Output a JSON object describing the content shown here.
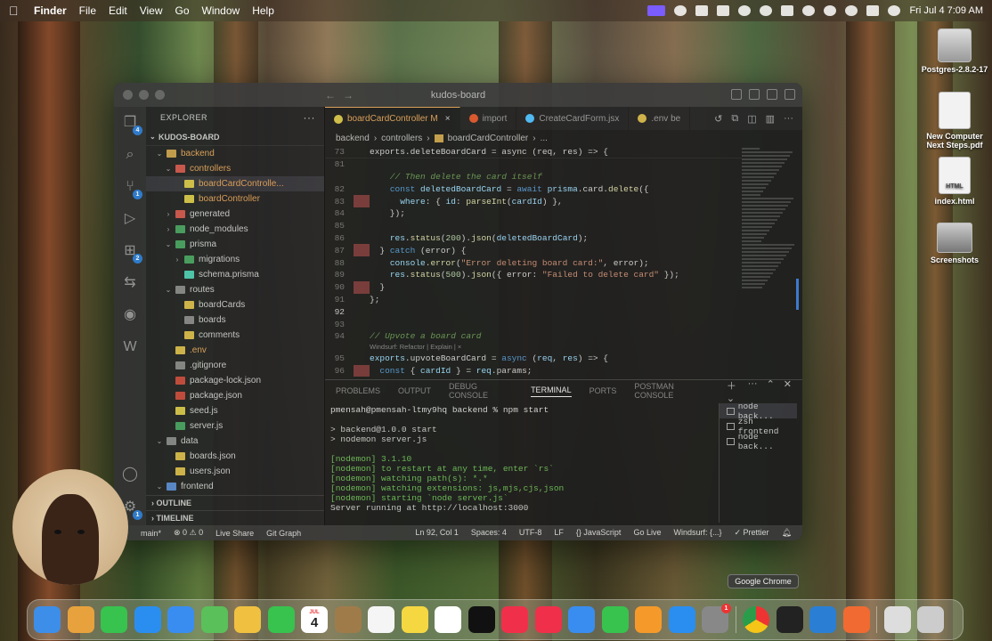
{
  "menubar": {
    "app": "Finder",
    "items": [
      "File",
      "Edit",
      "View",
      "Go",
      "Window",
      "Help"
    ],
    "clock": "Fri Jul 4  7:09 AM"
  },
  "desktop": {
    "items": [
      {
        "label": "Postgres-2.8.2-17"
      },
      {
        "label": "New Computer Next Steps.pdf"
      },
      {
        "label": "index.html",
        "icon_text": "HTML"
      },
      {
        "label": "Screenshots"
      }
    ]
  },
  "vscode": {
    "window_title": "kudos-board",
    "explorer": {
      "header": "EXPLORER",
      "root": "KUDOS-BOARD",
      "tree": [
        {
          "label": "backend",
          "chev": "⌄",
          "icon": "f-folder"
        },
        {
          "label": "controllers",
          "chev": "⌄",
          "icon": "f-red"
        },
        {
          "label": "boardCardControlle...",
          "chev": "",
          "icon": "f-js"
        },
        {
          "label": "boardController",
          "chev": "",
          "icon": "f-js"
        },
        {
          "label": "generated",
          "chev": "›",
          "icon": "f-red"
        },
        {
          "label": "node_modules",
          "chev": "›",
          "icon": "f-green"
        },
        {
          "label": "prisma",
          "chev": "⌄",
          "icon": "f-green"
        },
        {
          "label": "migrations",
          "chev": "›",
          "icon": "f-green"
        },
        {
          "label": "schema.prisma",
          "chev": "",
          "icon": "f-prisma"
        },
        {
          "label": "routes",
          "chev": "⌄",
          "icon": "f-gray"
        },
        {
          "label": "boardCards",
          "chev": "",
          "icon": "f-json"
        },
        {
          "label": "boards",
          "chev": "",
          "icon": "f-gray"
        },
        {
          "label": "comments",
          "chev": "",
          "icon": "f-json"
        },
        {
          "label": ".env",
          "chev": "",
          "icon": "f-json"
        },
        {
          "label": ".gitignore",
          "chev": "",
          "icon": "f-gray"
        },
        {
          "label": "package-lock.json",
          "chev": "",
          "icon": "f-pkg"
        },
        {
          "label": "package.json",
          "chev": "",
          "icon": "f-pkg"
        },
        {
          "label": "seed.js",
          "chev": "",
          "icon": "f-js"
        },
        {
          "label": "server.js",
          "chev": "",
          "icon": "f-green"
        },
        {
          "label": "data",
          "chev": "⌄",
          "icon": "f-gray"
        },
        {
          "label": "boards.json",
          "chev": "",
          "icon": "f-json"
        },
        {
          "label": "users.json",
          "chev": "",
          "icon": "f-json"
        },
        {
          "label": "frontend",
          "chev": "⌄",
          "icon": "f-blue"
        }
      ],
      "outline": "OUTLINE",
      "timeline": "TIMELINE"
    },
    "tabs": [
      {
        "label": "boardCardController M",
        "active": true,
        "close": "×"
      },
      {
        "label": "import",
        "active": false
      },
      {
        "label": "CreateCardForm.jsx",
        "active": false
      },
      {
        "label": ".env be",
        "active": false
      }
    ],
    "breadcrumb": [
      "backend",
      "controllers",
      "boardCardController",
      "..."
    ],
    "code": {
      "sticky": {
        "num": "73",
        "text": "exports.deleteBoardCard = async (req, res) => {"
      },
      "lines": [
        {
          "num": "81",
          "text": "",
          "gutter": false
        },
        {
          "num": "",
          "text": "    // Then delete the card itself",
          "cls": "cm",
          "gutter": false
        },
        {
          "num": "82",
          "text": "    const deletedBoardCard = await prisma.card.delete({",
          "gutter": false
        },
        {
          "num": "83",
          "text": "      where: { id: parseInt(cardId) },",
          "gutter": true
        },
        {
          "num": "84",
          "text": "    });",
          "gutter": false
        },
        {
          "num": "85",
          "text": "",
          "gutter": false
        },
        {
          "num": "86",
          "text": "    res.status(200).json(deletedBoardCard);",
          "gutter": false
        },
        {
          "num": "87",
          "text": "  } catch (error) {",
          "gutter": true
        },
        {
          "num": "88",
          "text": "    console.error(\"Error deleting board card:\", error);",
          "gutter": false
        },
        {
          "num": "89",
          "text": "    res.status(500).json({ error: \"Failed to delete card\" });",
          "gutter": false
        },
        {
          "num": "90",
          "text": "  }",
          "gutter": true
        },
        {
          "num": "91",
          "text": "};",
          "gutter": false
        },
        {
          "num": "92",
          "text": "",
          "gutter": false,
          "current": true
        },
        {
          "num": "93",
          "text": "",
          "gutter": false
        },
        {
          "num": "94",
          "text": "// Upvote a board card",
          "cls": "cm",
          "gutter": false
        },
        {
          "num": "",
          "text": "Windsurf: Refactor | Explain | ×",
          "codelens": true
        },
        {
          "num": "95",
          "text": "exports.upvoteBoardCard = async (req, res) => {",
          "gutter": false
        },
        {
          "num": "96",
          "text": "  const { cardId } = req.params;",
          "gutter": true
        }
      ]
    },
    "panel": {
      "tabs": [
        "PROBLEMS",
        "OUTPUT",
        "DEBUG CONSOLE",
        "TERMINAL",
        "PORTS",
        "POSTMAN CONSOLE"
      ],
      "active_tab": "TERMINAL",
      "terminal_lines": [
        {
          "text": "pmensah@pmensah-ltmy9hq backend % npm start",
          "cls": "prompt"
        },
        {
          "text": "",
          "cls": ""
        },
        {
          "text": "> backend@1.0.0 start",
          "cls": ""
        },
        {
          "text": "> nodemon server.js",
          "cls": ""
        },
        {
          "text": "",
          "cls": ""
        },
        {
          "text": "[nodemon] 3.1.10",
          "cls": "g"
        },
        {
          "text": "[nodemon] to restart at any time, enter `rs`",
          "cls": "g"
        },
        {
          "text": "[nodemon] watching path(s): *.*",
          "cls": "g"
        },
        {
          "text": "[nodemon] watching extensions: js,mjs,cjs,json",
          "cls": "g"
        },
        {
          "text": "[nodemon] starting `node server.js`",
          "cls": "g"
        },
        {
          "text": "Server running at http://localhost:3000",
          "cls": ""
        }
      ],
      "terminals": [
        {
          "label": "node back...",
          "selected": true
        },
        {
          "label": "zsh frontend",
          "selected": false
        },
        {
          "label": "node back...",
          "selected": false
        }
      ]
    },
    "statusbar": {
      "left": [
        "main*",
        "⊗ 0 ⚠ 0",
        "Live Share",
        "Git Graph"
      ],
      "right": [
        "Ln 92, Col 1",
        "Spaces: 4",
        "UTF-8",
        "LF",
        "{} JavaScript",
        "Go Live",
        "Windsurf: {...}",
        "✓ Prettier"
      ]
    }
  },
  "dock": {
    "tooltip": "Google Chrome",
    "calendar_month": "JUL",
    "calendar_day": "4",
    "settings_badge": "1",
    "apps": [
      {
        "name": "finder",
        "color": "#3d8ee8"
      },
      {
        "name": "launchpad",
        "color": "#e8a23d"
      },
      {
        "name": "messages",
        "color": "#38c24e"
      },
      {
        "name": "safari",
        "color": "#2a8ef0"
      },
      {
        "name": "mail",
        "color": "#3a8df0"
      },
      {
        "name": "maps",
        "color": "#5ac05a"
      },
      {
        "name": "photos",
        "color": "#f0c040"
      },
      {
        "name": "facetime",
        "color": "#38c24e"
      },
      {
        "name": "calendar",
        "color": "#ffffff"
      },
      {
        "name": "notes-brown",
        "color": "#a07b4a"
      },
      {
        "name": "reminders",
        "color": "#f5f5f5"
      },
      {
        "name": "notes",
        "color": "#f5d742"
      },
      {
        "name": "freeform",
        "color": "#ffffff"
      },
      {
        "name": "apple-tv",
        "color": "#111111"
      },
      {
        "name": "music",
        "color": "#f0304a"
      },
      {
        "name": "news",
        "color": "#f0304a"
      },
      {
        "name": "keynote",
        "color": "#3a8df0"
      },
      {
        "name": "numbers",
        "color": "#38c24e"
      },
      {
        "name": "pages",
        "color": "#f59a2a"
      },
      {
        "name": "app-store",
        "color": "#2a8ef0"
      },
      {
        "name": "system-settings",
        "color": "#888888"
      },
      {
        "name": "chrome",
        "color": "#ffffff"
      },
      {
        "name": "terminal",
        "color": "#222222"
      },
      {
        "name": "vscode",
        "color": "#2a7fd4"
      },
      {
        "name": "postman",
        "color": "#f06a32"
      },
      {
        "name": "downloads",
        "color": "#dddddd"
      },
      {
        "name": "trash",
        "color": "#cccccc"
      }
    ]
  }
}
